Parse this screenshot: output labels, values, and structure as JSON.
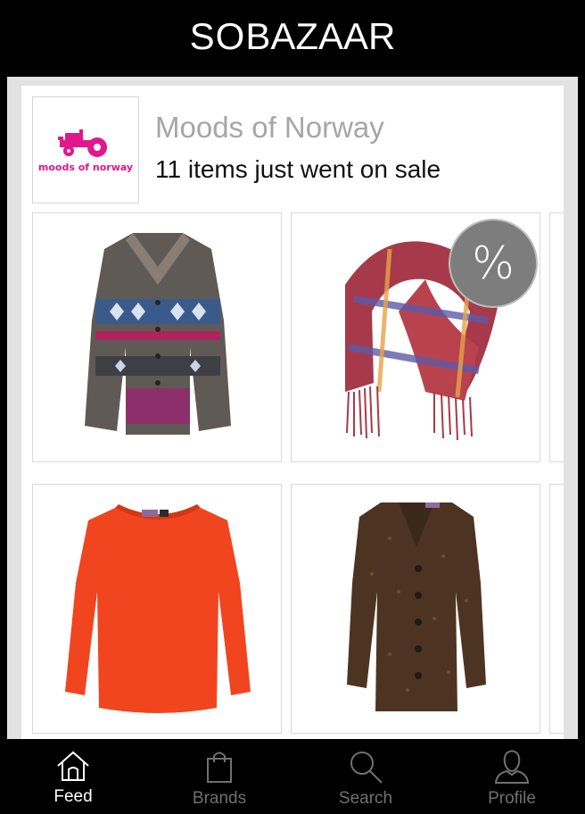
{
  "header": {
    "logo_thin": "SO",
    "logo_bold": "BAZAAR"
  },
  "feed": {
    "card": {
      "brand_logo_text": "moods of norway",
      "brand_name": "Moods of Norway",
      "description": "11 items just went on sale",
      "sale_badge": "%",
      "items": [
        {
          "name": "patterned-knit-cardigan",
          "on_sale_badge": false
        },
        {
          "name": "plaid-scarf",
          "on_sale_badge": true
        },
        {
          "name": "orange-long-sleeve-top",
          "on_sale_badge": false
        },
        {
          "name": "brown-tweed-cardigan",
          "on_sale_badge": false
        }
      ]
    }
  },
  "tabbar": {
    "tabs": [
      {
        "label": "Feed",
        "icon": "home-icon",
        "active": true
      },
      {
        "label": "Brands",
        "icon": "shopping-bag-icon",
        "active": false
      },
      {
        "label": "Search",
        "icon": "search-icon",
        "active": false
      },
      {
        "label": "Profile",
        "icon": "user-icon",
        "active": false
      }
    ]
  },
  "colors": {
    "brand_pink": "#e0188c",
    "inactive_tab": "#707070",
    "sale_badge": "#7d7d7d"
  }
}
